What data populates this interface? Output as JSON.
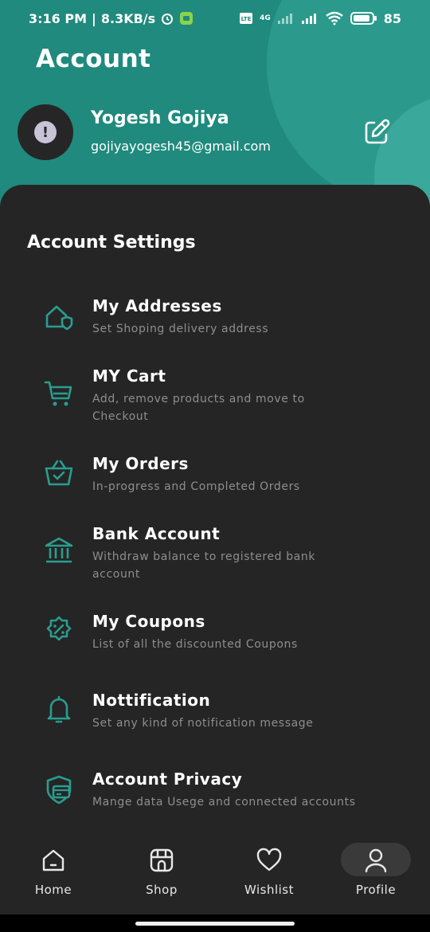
{
  "status_bar": {
    "time": "3:16 PM",
    "separator": "|",
    "speed": "8.3KB/s",
    "network": "4G",
    "battery": "85"
  },
  "header": {
    "title": "Account",
    "user_name": "Yogesh Gojiya",
    "user_email": "gojiyayogesh45@gmail.com"
  },
  "settings": {
    "section_title": "Account Settings",
    "items": [
      {
        "title": "My Addresses",
        "subtitle": "Set Shoping delivery address",
        "icon": "home-shield-icon"
      },
      {
        "title": "MY Cart",
        "subtitle": "Add, remove products and move to Checkout",
        "icon": "cart-icon"
      },
      {
        "title": "My Orders",
        "subtitle": "In-progress and Completed Orders",
        "icon": "basket-icon"
      },
      {
        "title": "Bank Account",
        "subtitle": "Withdraw balance to registered bank account",
        "icon": "bank-icon"
      },
      {
        "title": "My Coupons",
        "subtitle": "List of all the discounted Coupons",
        "icon": "coupon-icon"
      },
      {
        "title": "Nottification",
        "subtitle": "Set any kind of notification message",
        "icon": "bell-icon"
      },
      {
        "title": "Account Privacy",
        "subtitle": "Mange data Usege and connected accounts",
        "icon": "privacy-card-icon"
      }
    ]
  },
  "bottom_nav": {
    "items": [
      {
        "label": "Home",
        "icon": "home-icon"
      },
      {
        "label": "Shop",
        "icon": "shop-icon"
      },
      {
        "label": "Wishlist",
        "icon": "heart-icon"
      },
      {
        "label": "Profile",
        "icon": "user-icon"
      }
    ],
    "active": "Profile"
  },
  "colors": {
    "accent": "#1f8a7d",
    "icon_teal": "#2a9d8f",
    "sheet": "#252525"
  }
}
